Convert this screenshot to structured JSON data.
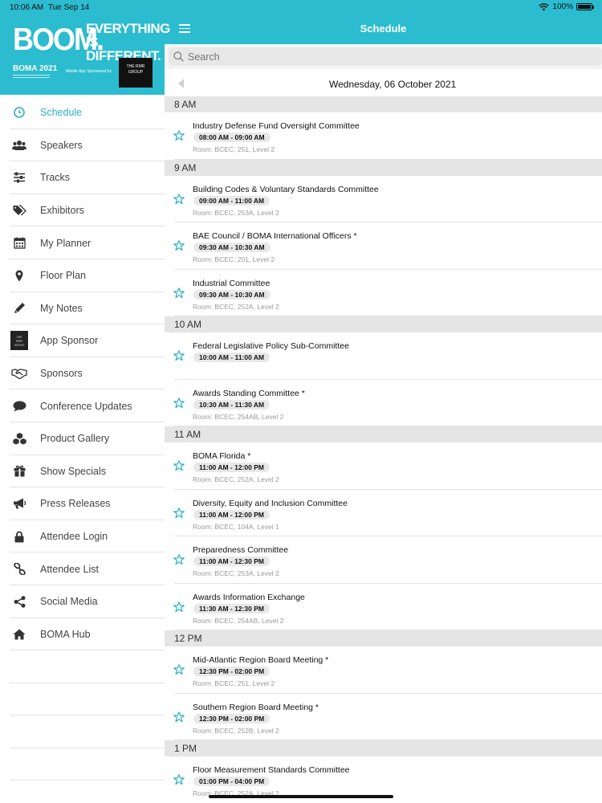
{
  "status": {
    "time": "10:06 AM",
    "date": "Tue Sep 14",
    "battery": "100%"
  },
  "banner": {
    "boom": "BOOM.",
    "tagline_1": "EVERYTHING IS",
    "tagline_2": "DIFFERENT.",
    "boma": "BOMA 2021",
    "sponsored": "Mobile App Sponsored by",
    "sponsor_logo": "THE RMR GROUP"
  },
  "sidebar": {
    "items": [
      {
        "label": "Schedule",
        "icon": "clock-icon"
      },
      {
        "label": "Speakers",
        "icon": "people-icon"
      },
      {
        "label": "Tracks",
        "icon": "sliders-icon"
      },
      {
        "label": "Exhibitors",
        "icon": "tags-icon"
      },
      {
        "label": "My Planner",
        "icon": "calendar-icon"
      },
      {
        "label": "Floor Plan",
        "icon": "map-pin-icon"
      },
      {
        "label": "My Notes",
        "icon": "pencil-icon"
      },
      {
        "label": "App Sponsor",
        "icon": "sponsor-logo-icon"
      },
      {
        "label": "Sponsors",
        "icon": "handshake-icon"
      },
      {
        "label": "Conference Updates",
        "icon": "chat-bubble-icon"
      },
      {
        "label": "Product Gallery",
        "icon": "cubes-icon"
      },
      {
        "label": "Show Specials",
        "icon": "gift-icon"
      },
      {
        "label": "Press Releases",
        "icon": "megaphone-icon"
      },
      {
        "label": "Attendee Login",
        "icon": "lock-icon"
      },
      {
        "label": "Attendee List",
        "icon": "link-icon"
      },
      {
        "label": "Social Media",
        "icon": "share-icon"
      },
      {
        "label": "BOMA Hub",
        "icon": "home-icon"
      }
    ]
  },
  "header": {
    "title": "Schedule"
  },
  "search": {
    "placeholder": "Search"
  },
  "date_bar": {
    "date": "Wednesday, 06 October 2021"
  },
  "schedule": [
    {
      "hour": "8 AM",
      "sessions": [
        {
          "name": "Industry Defense Fund Oversight Committee",
          "time": "08:00 AM - 09:00 AM",
          "room": "Room:  BCEC, 251, Level 2"
        }
      ]
    },
    {
      "hour": "9 AM",
      "sessions": [
        {
          "name": "Building Codes & Voluntary Standards Committee",
          "time": "09:00 AM - 11:00 AM",
          "room": "Room:  BCEC, 253A, Level 2"
        },
        {
          "name": "BAE Council / BOMA International Officers *",
          "time": "09:30 AM - 10:30 AM",
          "room": "Room:  BCEC, 201, Level 2"
        },
        {
          "name": "Industrial Committee",
          "time": "09:30 AM - 10:30 AM",
          "room": "Room:  BCEC, 252A, Level 2"
        }
      ]
    },
    {
      "hour": "10 AM",
      "sessions": [
        {
          "name": "Federal Legislative Policy Sub-Committee",
          "time": "10:00 AM - 11:00 AM",
          "room": ""
        },
        {
          "name": "Awards Standing Committee *",
          "time": "10:30 AM - 11:30 AM",
          "room": "Room:  BCEC, 254AB, Level 2"
        }
      ]
    },
    {
      "hour": "11 AM",
      "sessions": [
        {
          "name": "BOMA Florida *",
          "time": "11:00 AM - 12:00 PM",
          "room": "Room:  BCEC, 252A, Level 2"
        },
        {
          "name": "Diversity, Equity and Inclusion Committee",
          "time": "11:00 AM - 12:00 PM",
          "room": "Room:  BCEC, 104A, Level 1"
        },
        {
          "name": "Preparedness Committee",
          "time": "11:00 AM - 12:30 PM",
          "room": "Room:  BCEC, 253A, Level 2"
        },
        {
          "name": "Awards Information Exchange",
          "time": "11:30 AM - 12:30 PM",
          "room": "Room:  BCEC, 254AB, Level 2"
        }
      ]
    },
    {
      "hour": "12 PM",
      "sessions": [
        {
          "name": "Mid-Atlantic Region Board Meeting *",
          "time": "12:30 PM - 02:00 PM",
          "room": "Room:  BCEC, 251, Level 2"
        },
        {
          "name": "Southern Region Board Meeting *",
          "time": "12:30 PM - 02:00 PM",
          "room": "Room:  BCEC, 252B, Level 2"
        }
      ]
    },
    {
      "hour": "1 PM",
      "sessions": [
        {
          "name": "Floor Measurement Standards Committee",
          "time": "01:00 PM - 04:00 PM",
          "room": "Room:  BCEC, 252A, Level 2"
        }
      ]
    }
  ],
  "colors": {
    "accent": "#2bbcd0",
    "active_text": "#2bb0c4"
  }
}
